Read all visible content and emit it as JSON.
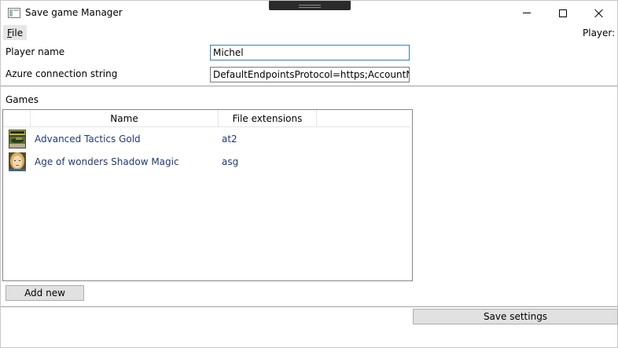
{
  "window": {
    "title": "Save game Manager",
    "icon": "window-app-icon"
  },
  "menu": {
    "file_first": "F",
    "file_rest": "ile"
  },
  "header": {
    "player_label": "Player:"
  },
  "form": {
    "player_name_label": "Player name",
    "player_name_value": "Michel",
    "azure_label": "Azure connection string",
    "azure_value": "DefaultEndpointsProtocol=https;AccountName"
  },
  "games": {
    "section_label": "Games",
    "columns": [
      "",
      "Name",
      "File extensions"
    ],
    "rows": [
      {
        "name": "Advanced Tactics Gold",
        "extension": "at2",
        "icon": "tank-game-icon"
      },
      {
        "name": "Age of wonders Shadow Magic",
        "extension": "asg",
        "icon": "portrait-game-icon"
      }
    ],
    "add_new_label": "Add new"
  },
  "footer": {
    "save_label": "Save settings"
  },
  "colors": {
    "accent_border": "#3c7fb1",
    "link_text": "#1f3a73",
    "button_bg": "#e1e1e1"
  }
}
